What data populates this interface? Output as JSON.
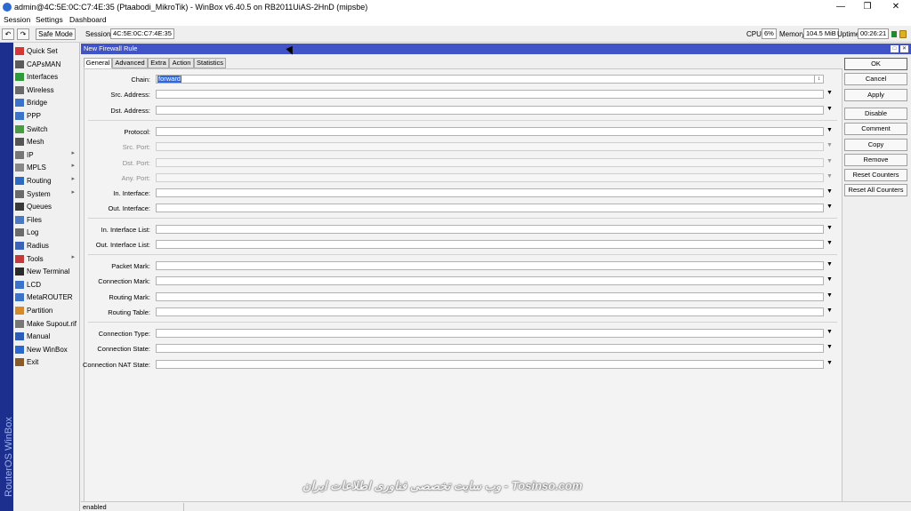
{
  "window": {
    "title": "admin@4C:5E:0C:C7:4E:35 (Ptaabodi_MikroTik) - WinBox v6.40.5 on RB2011UiAS-2HnD (mipsbe)",
    "minimize": "—",
    "maximize": "❐",
    "close": "✕"
  },
  "menu": {
    "session": "Session",
    "settings": "Settings",
    "dashboard": "Dashboard"
  },
  "toolbar": {
    "undo": "↶",
    "redo": "↷",
    "safe_mode": "Safe Mode",
    "session_label": "Session:",
    "session_value": "4C:5E:0C:C7:4E:35",
    "cpu_label": "CPU:",
    "cpu_value": "6%",
    "memory_label": "Memory:",
    "memory_value": "104.5 MiB",
    "uptime_label": "Uptime:",
    "uptime_value": "00:26:21"
  },
  "branding": "RouterOS WinBox",
  "sidebar": {
    "items": [
      {
        "label": "Quick Set",
        "icon": "quick-set-icon",
        "color": "#d2383a",
        "arrow": ""
      },
      {
        "label": "CAPsMAN",
        "icon": "capsman-icon",
        "color": "#5b5b5b",
        "arrow": ""
      },
      {
        "label": "Interfaces",
        "icon": "interfaces-icon",
        "color": "#2f9a3a",
        "arrow": ""
      },
      {
        "label": "Wireless",
        "icon": "wireless-icon",
        "color": "#6a6a6a",
        "arrow": ""
      },
      {
        "label": "Bridge",
        "icon": "bridge-icon",
        "color": "#3a73c8",
        "arrow": ""
      },
      {
        "label": "PPP",
        "icon": "ppp-icon",
        "color": "#3a73c8",
        "arrow": ""
      },
      {
        "label": "Switch",
        "icon": "switch-icon",
        "color": "#4a9a46",
        "arrow": ""
      },
      {
        "label": "Mesh",
        "icon": "mesh-icon",
        "color": "#555555",
        "arrow": ""
      },
      {
        "label": "IP",
        "icon": "ip-icon",
        "color": "#777777",
        "arrow": "▸"
      },
      {
        "label": "MPLS",
        "icon": "mpls-icon",
        "color": "#888888",
        "arrow": "▸"
      },
      {
        "label": "Routing",
        "icon": "routing-icon",
        "color": "#2f6ac2",
        "arrow": "▸"
      },
      {
        "label": "System",
        "icon": "system-icon",
        "color": "#6a6a6a",
        "arrow": "▸"
      },
      {
        "label": "Queues",
        "icon": "queues-icon",
        "color": "#3a3a3a",
        "arrow": ""
      },
      {
        "label": "Files",
        "icon": "files-icon",
        "color": "#4a78c4",
        "arrow": ""
      },
      {
        "label": "Log",
        "icon": "log-icon",
        "color": "#6b6b6b",
        "arrow": ""
      },
      {
        "label": "Radius",
        "icon": "radius-icon",
        "color": "#3a63b8",
        "arrow": ""
      },
      {
        "label": "Tools",
        "icon": "tools-icon",
        "color": "#c43a3a",
        "arrow": "▸"
      },
      {
        "label": "New Terminal",
        "icon": "terminal-icon",
        "color": "#2b2b2b",
        "arrow": ""
      },
      {
        "label": "LCD",
        "icon": "lcd-icon",
        "color": "#3a73c8",
        "arrow": ""
      },
      {
        "label": "MetaROUTER",
        "icon": "metarouter-icon",
        "color": "#3a73c8",
        "arrow": ""
      },
      {
        "label": "Partition",
        "icon": "partition-icon",
        "color": "#d48a2a",
        "arrow": ""
      },
      {
        "label": "Make Supout.rif",
        "icon": "supout-icon",
        "color": "#777777",
        "arrow": ""
      },
      {
        "label": "Manual",
        "icon": "manual-icon",
        "color": "#2a5cb8",
        "arrow": ""
      },
      {
        "label": "New WinBox",
        "icon": "winbox-icon",
        "color": "#2a6acf",
        "arrow": ""
      },
      {
        "label": "Exit",
        "icon": "exit-icon",
        "color": "#8a5a2a",
        "arrow": ""
      }
    ]
  },
  "dialog": {
    "title": "New Firewall Rule",
    "restore_btn": "□",
    "close_btn": "✕",
    "tabs": [
      "General",
      "Advanced",
      "Extra",
      "Action",
      "Statistics"
    ],
    "chain_value": "forward",
    "fields": {
      "chain": "Chain:",
      "src_address": "Src. Address:",
      "dst_address": "Dst. Address:",
      "protocol": "Protocol:",
      "src_port": "Src. Port:",
      "dst_port": "Dst. Port:",
      "any_port": "Any. Port:",
      "in_interface": "In. Interface:",
      "out_interface": "Out. Interface:",
      "in_interface_list": "In. Interface List:",
      "out_interface_list": "Out. Interface List:",
      "packet_mark": "Packet Mark:",
      "connection_mark": "Connection Mark:",
      "routing_mark": "Routing Mark:",
      "routing_table": "Routing Table:",
      "connection_type": "Connection Type:",
      "connection_state": "Connection State:",
      "connection_nat_state": "Connection NAT State:"
    },
    "dropdown_glyph": "▼",
    "spin_glyph": "↕",
    "buttons": {
      "ok": "OK",
      "cancel": "Cancel",
      "apply": "Apply",
      "disable": "Disable",
      "comment": "Comment",
      "copy": "Copy",
      "remove": "Remove",
      "reset_counters": "Reset Counters",
      "reset_all_counters": "Reset All Counters"
    },
    "status": "enabled"
  },
  "watermark": "وب سایت تخصصی فناوری اطلاعات ایران - Tosinso.com"
}
